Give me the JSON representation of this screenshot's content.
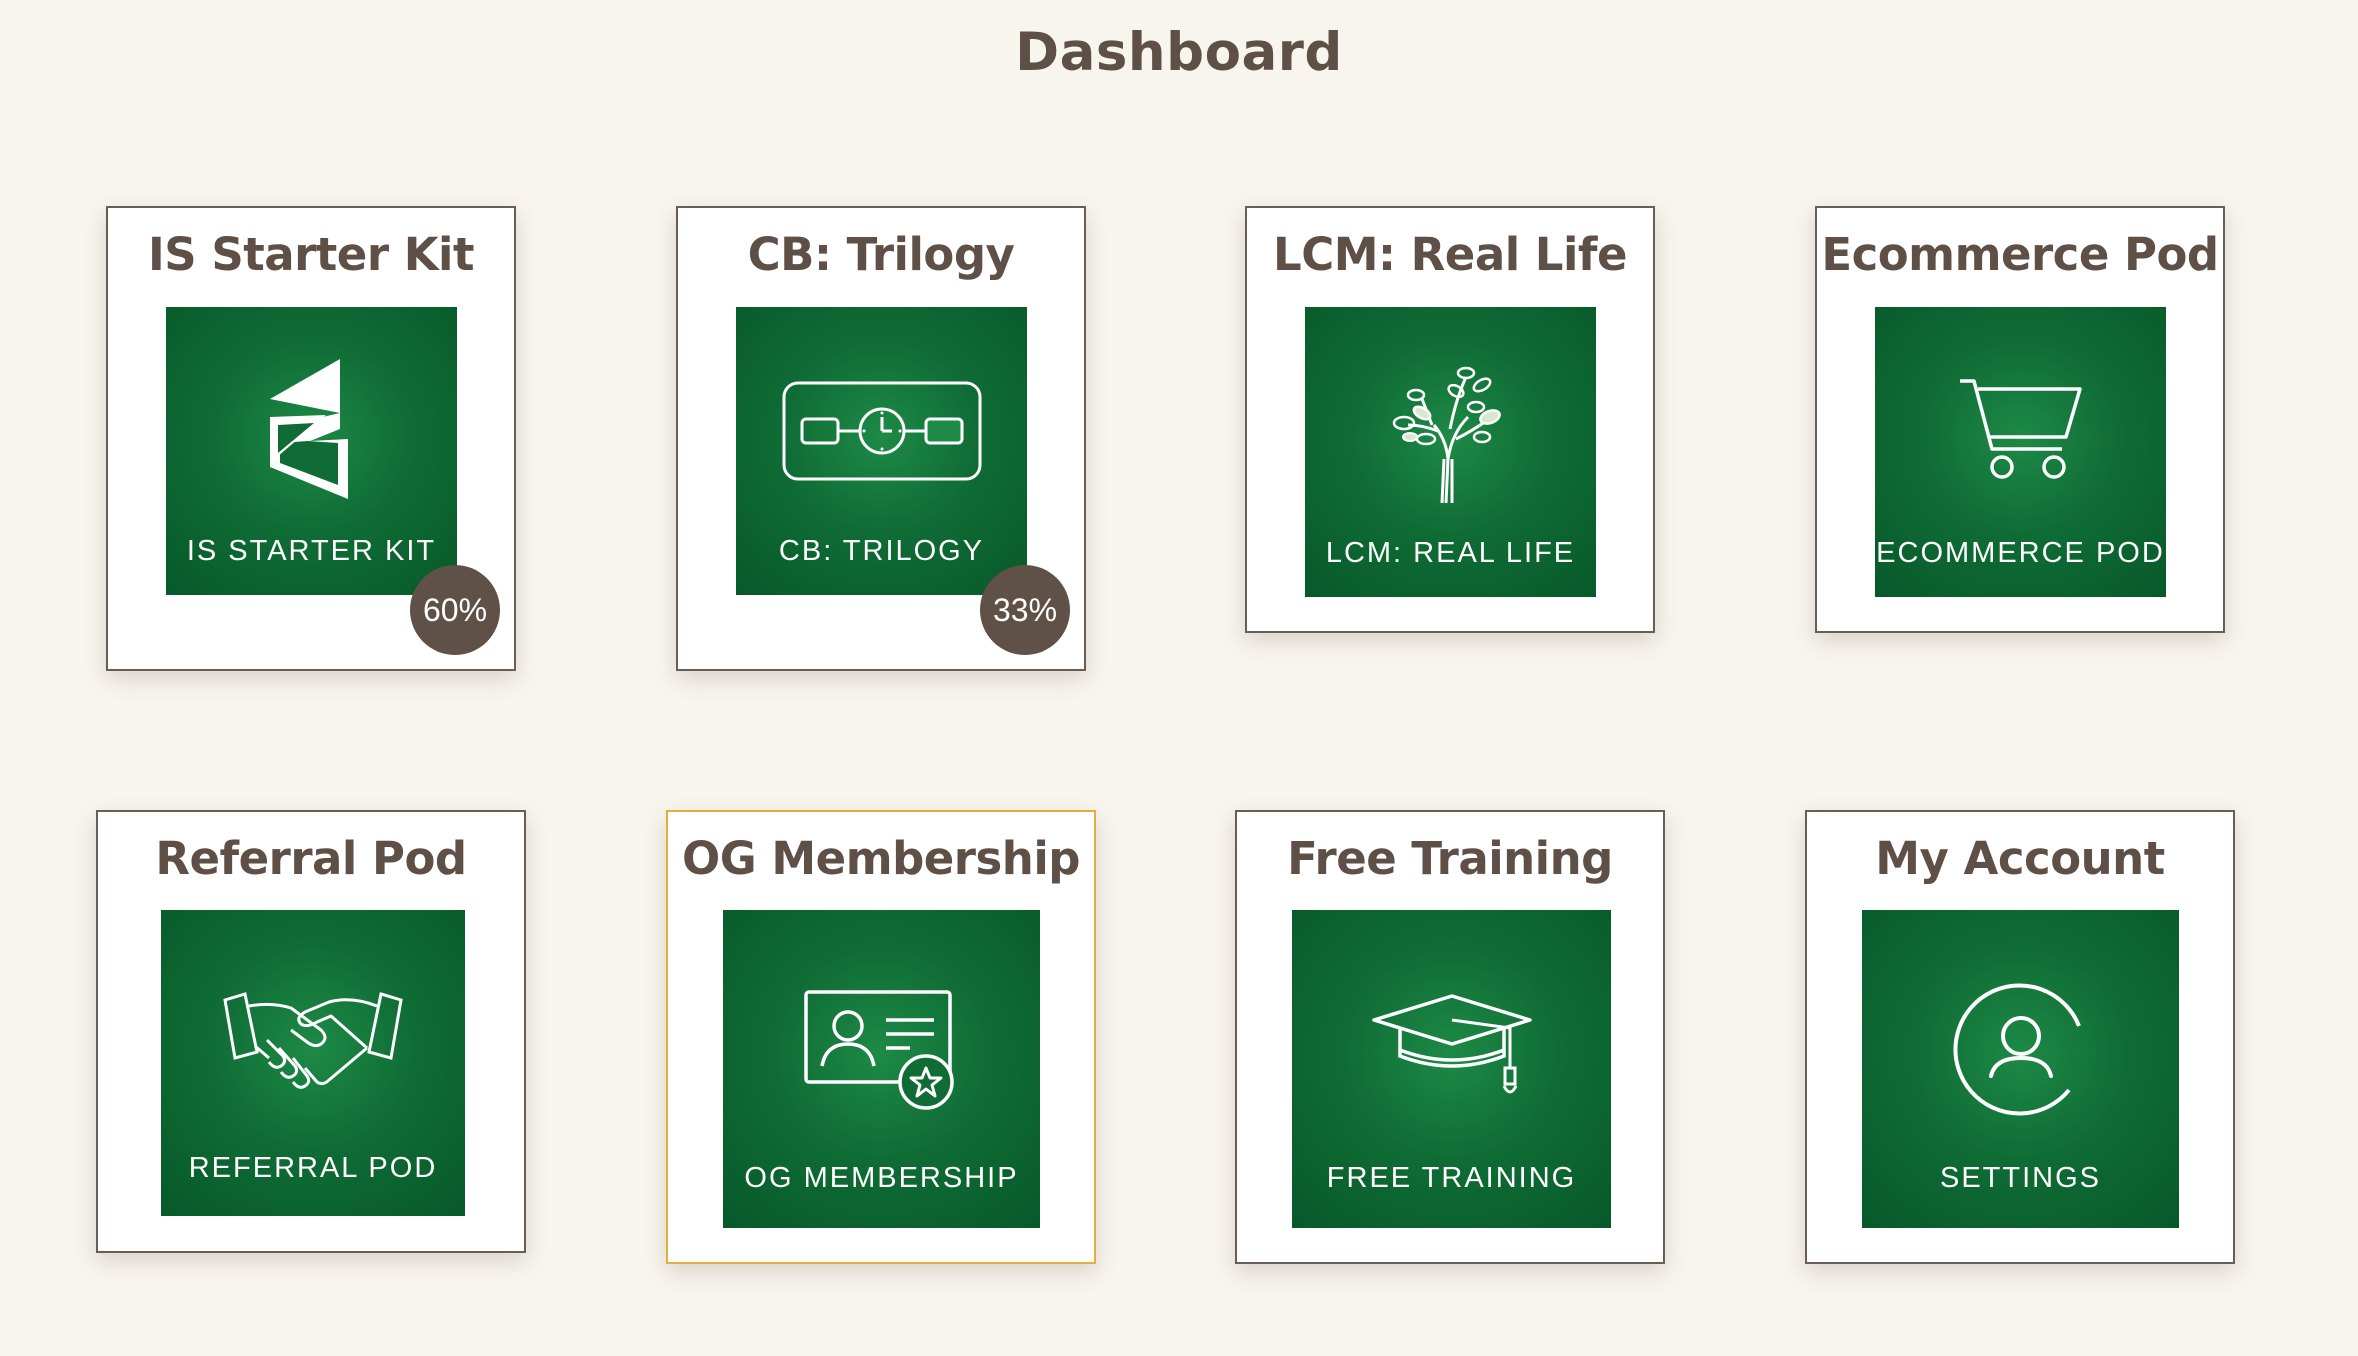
{
  "page": {
    "title": "Dashboard"
  },
  "colors": {
    "background": "#f8f5ef",
    "tile_green": "#0f6c35",
    "text_brown": "#5e5047",
    "badge": "#5f5048",
    "selected_border": "#e3ae3c"
  },
  "cards": [
    {
      "title": "IS Starter Kit",
      "tile_label": "IS STARTER KIT",
      "icon": "is-logo-icon",
      "progress": "60%"
    },
    {
      "title": "CB: Trilogy",
      "tile_label": "CB: TRILOGY",
      "icon": "timeline-clock-icon",
      "progress": "33%"
    },
    {
      "title": "LCM: Real Life",
      "tile_label": "LCM: REAL LIFE",
      "icon": "tree-icon"
    },
    {
      "title": "Ecommerce Pod",
      "tile_label": "ECOMMERCE POD",
      "icon": "shopping-cart-icon"
    },
    {
      "title": "Referral Pod",
      "tile_label": "REFERRAL POD",
      "icon": "handshake-icon"
    },
    {
      "title": "OG Membership",
      "tile_label": "OG MEMBERSHIP",
      "icon": "membership-card-icon",
      "selected": true
    },
    {
      "title": "Free Training",
      "tile_label": "FREE TRAINING",
      "icon": "graduation-cap-icon"
    },
    {
      "title": "My Account",
      "tile_label": "SETTINGS",
      "icon": "user-circle-icon"
    }
  ]
}
